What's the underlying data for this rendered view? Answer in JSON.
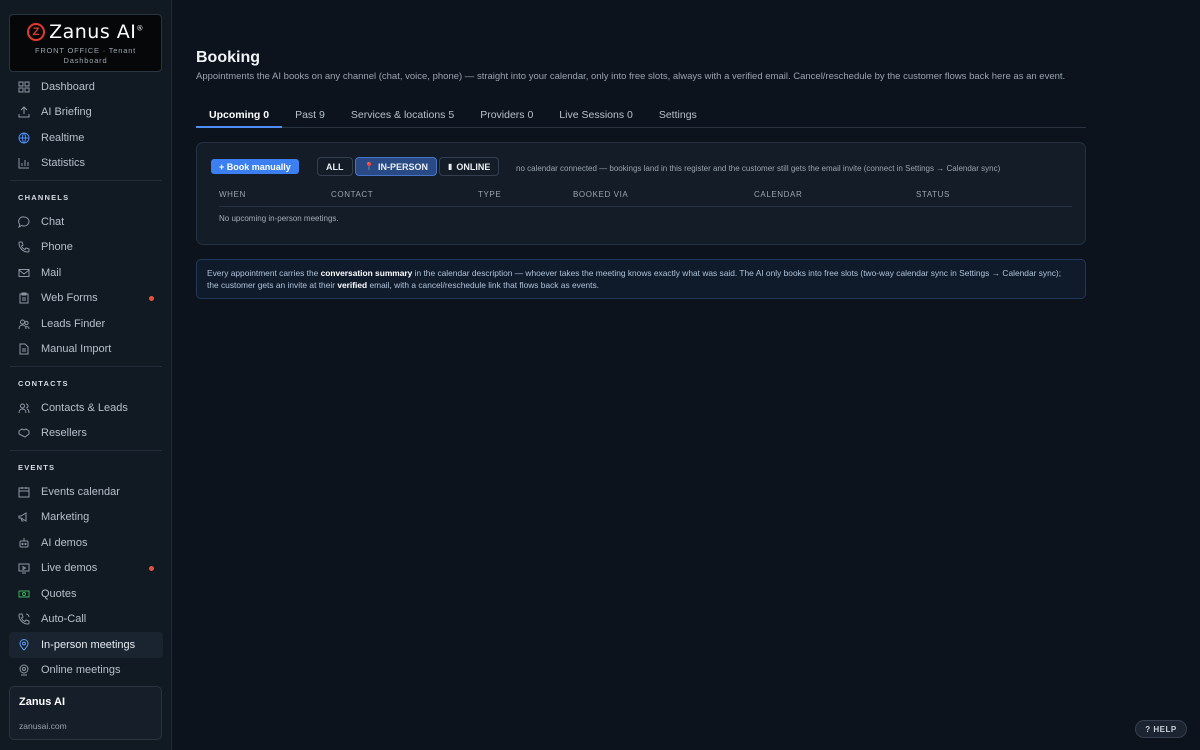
{
  "brand": {
    "name": "Zanus AI",
    "logo_letter": "Z",
    "line1": "FRONT OFFICE · Tenant",
    "line2": "Dashboard"
  },
  "sidebar": {
    "top_items": [
      {
        "label": "Dashboard",
        "icon": "grid-icon"
      },
      {
        "label": "AI Briefing",
        "icon": "upload-icon"
      },
      {
        "label": "Realtime",
        "icon": "globe-icon"
      },
      {
        "label": "Statistics",
        "icon": "bar-chart-icon"
      }
    ],
    "channels_title": "CHANNELS",
    "channels": [
      {
        "label": "Chat",
        "icon": "chat-icon"
      },
      {
        "label": "Phone",
        "icon": "phone-icon"
      },
      {
        "label": "Mail",
        "icon": "mail-icon"
      },
      {
        "label": "Web Forms",
        "icon": "clipboard-icon"
      },
      {
        "label": "Leads Finder",
        "icon": "users-icon"
      },
      {
        "label": "Manual Import",
        "icon": "document-icon"
      }
    ],
    "contacts_title": "CONTACTS",
    "contacts": [
      {
        "label": "Contacts & Leads",
        "icon": "people-icon"
      },
      {
        "label": "Resellers",
        "icon": "handshake-icon"
      }
    ],
    "events_title": "EVENTS",
    "events": [
      {
        "label": "Events calendar",
        "icon": "calendar-icon"
      },
      {
        "label": "Marketing",
        "icon": "megaphone-icon"
      },
      {
        "label": "AI demos",
        "icon": "robot-icon"
      },
      {
        "label": "Live demos",
        "icon": "screen-icon"
      },
      {
        "label": "Quotes",
        "icon": "money-icon"
      },
      {
        "label": "Auto-Call",
        "icon": "phone-call-icon"
      },
      {
        "label": "In-person meetings",
        "icon": "location-pin-icon"
      },
      {
        "label": "Online meetings",
        "icon": "webcam-icon"
      }
    ]
  },
  "tenant": {
    "name": "Zanus AI",
    "url": "zanusai.com"
  },
  "page": {
    "title": "Booking",
    "subtitle": "Appointments the AI books on any channel (chat, voice, phone) — straight into your calendar, only into free slots, always with a verified email. Cancel/reschedule by the customer flows back here as an event."
  },
  "tabs": [
    "Upcoming 0",
    "Past 9",
    "Services & locations 5",
    "Providers 0",
    "Live Sessions 0",
    "Settings"
  ],
  "toolbar": {
    "book_label": "+ Book manually",
    "filter_all": "ALL",
    "filter_inperson": "IN-PERSON",
    "filter_online": "ONLINE",
    "calendar_note": "no calendar connected — bookings land in this register and the customer still gets the email invite (connect in Settings → Calendar sync)"
  },
  "table": {
    "columns": [
      "WHEN",
      "CONTACT",
      "TYPE",
      "BOOKED VIA",
      "CALENDAR",
      "STATUS"
    ],
    "empty": "No upcoming in-person meetings."
  },
  "info": {
    "t1": "Every appointment carries the ",
    "b1": "conversation summary",
    "t2": " in the calendar description — whoever takes the meeting knows exactly what was said. The AI only books into free slots (two-way calendar sync in Settings → Calendar sync); the customer gets an invite at their ",
    "b2": "verified",
    "t3": " email, with a cancel/reschedule link that flows back as events."
  },
  "help_label": "? HELP",
  "colors": {
    "accent": "#3b7ff0",
    "background": "#0c131d",
    "sidebar": "#111923",
    "alert_dot": "#e5533d"
  }
}
